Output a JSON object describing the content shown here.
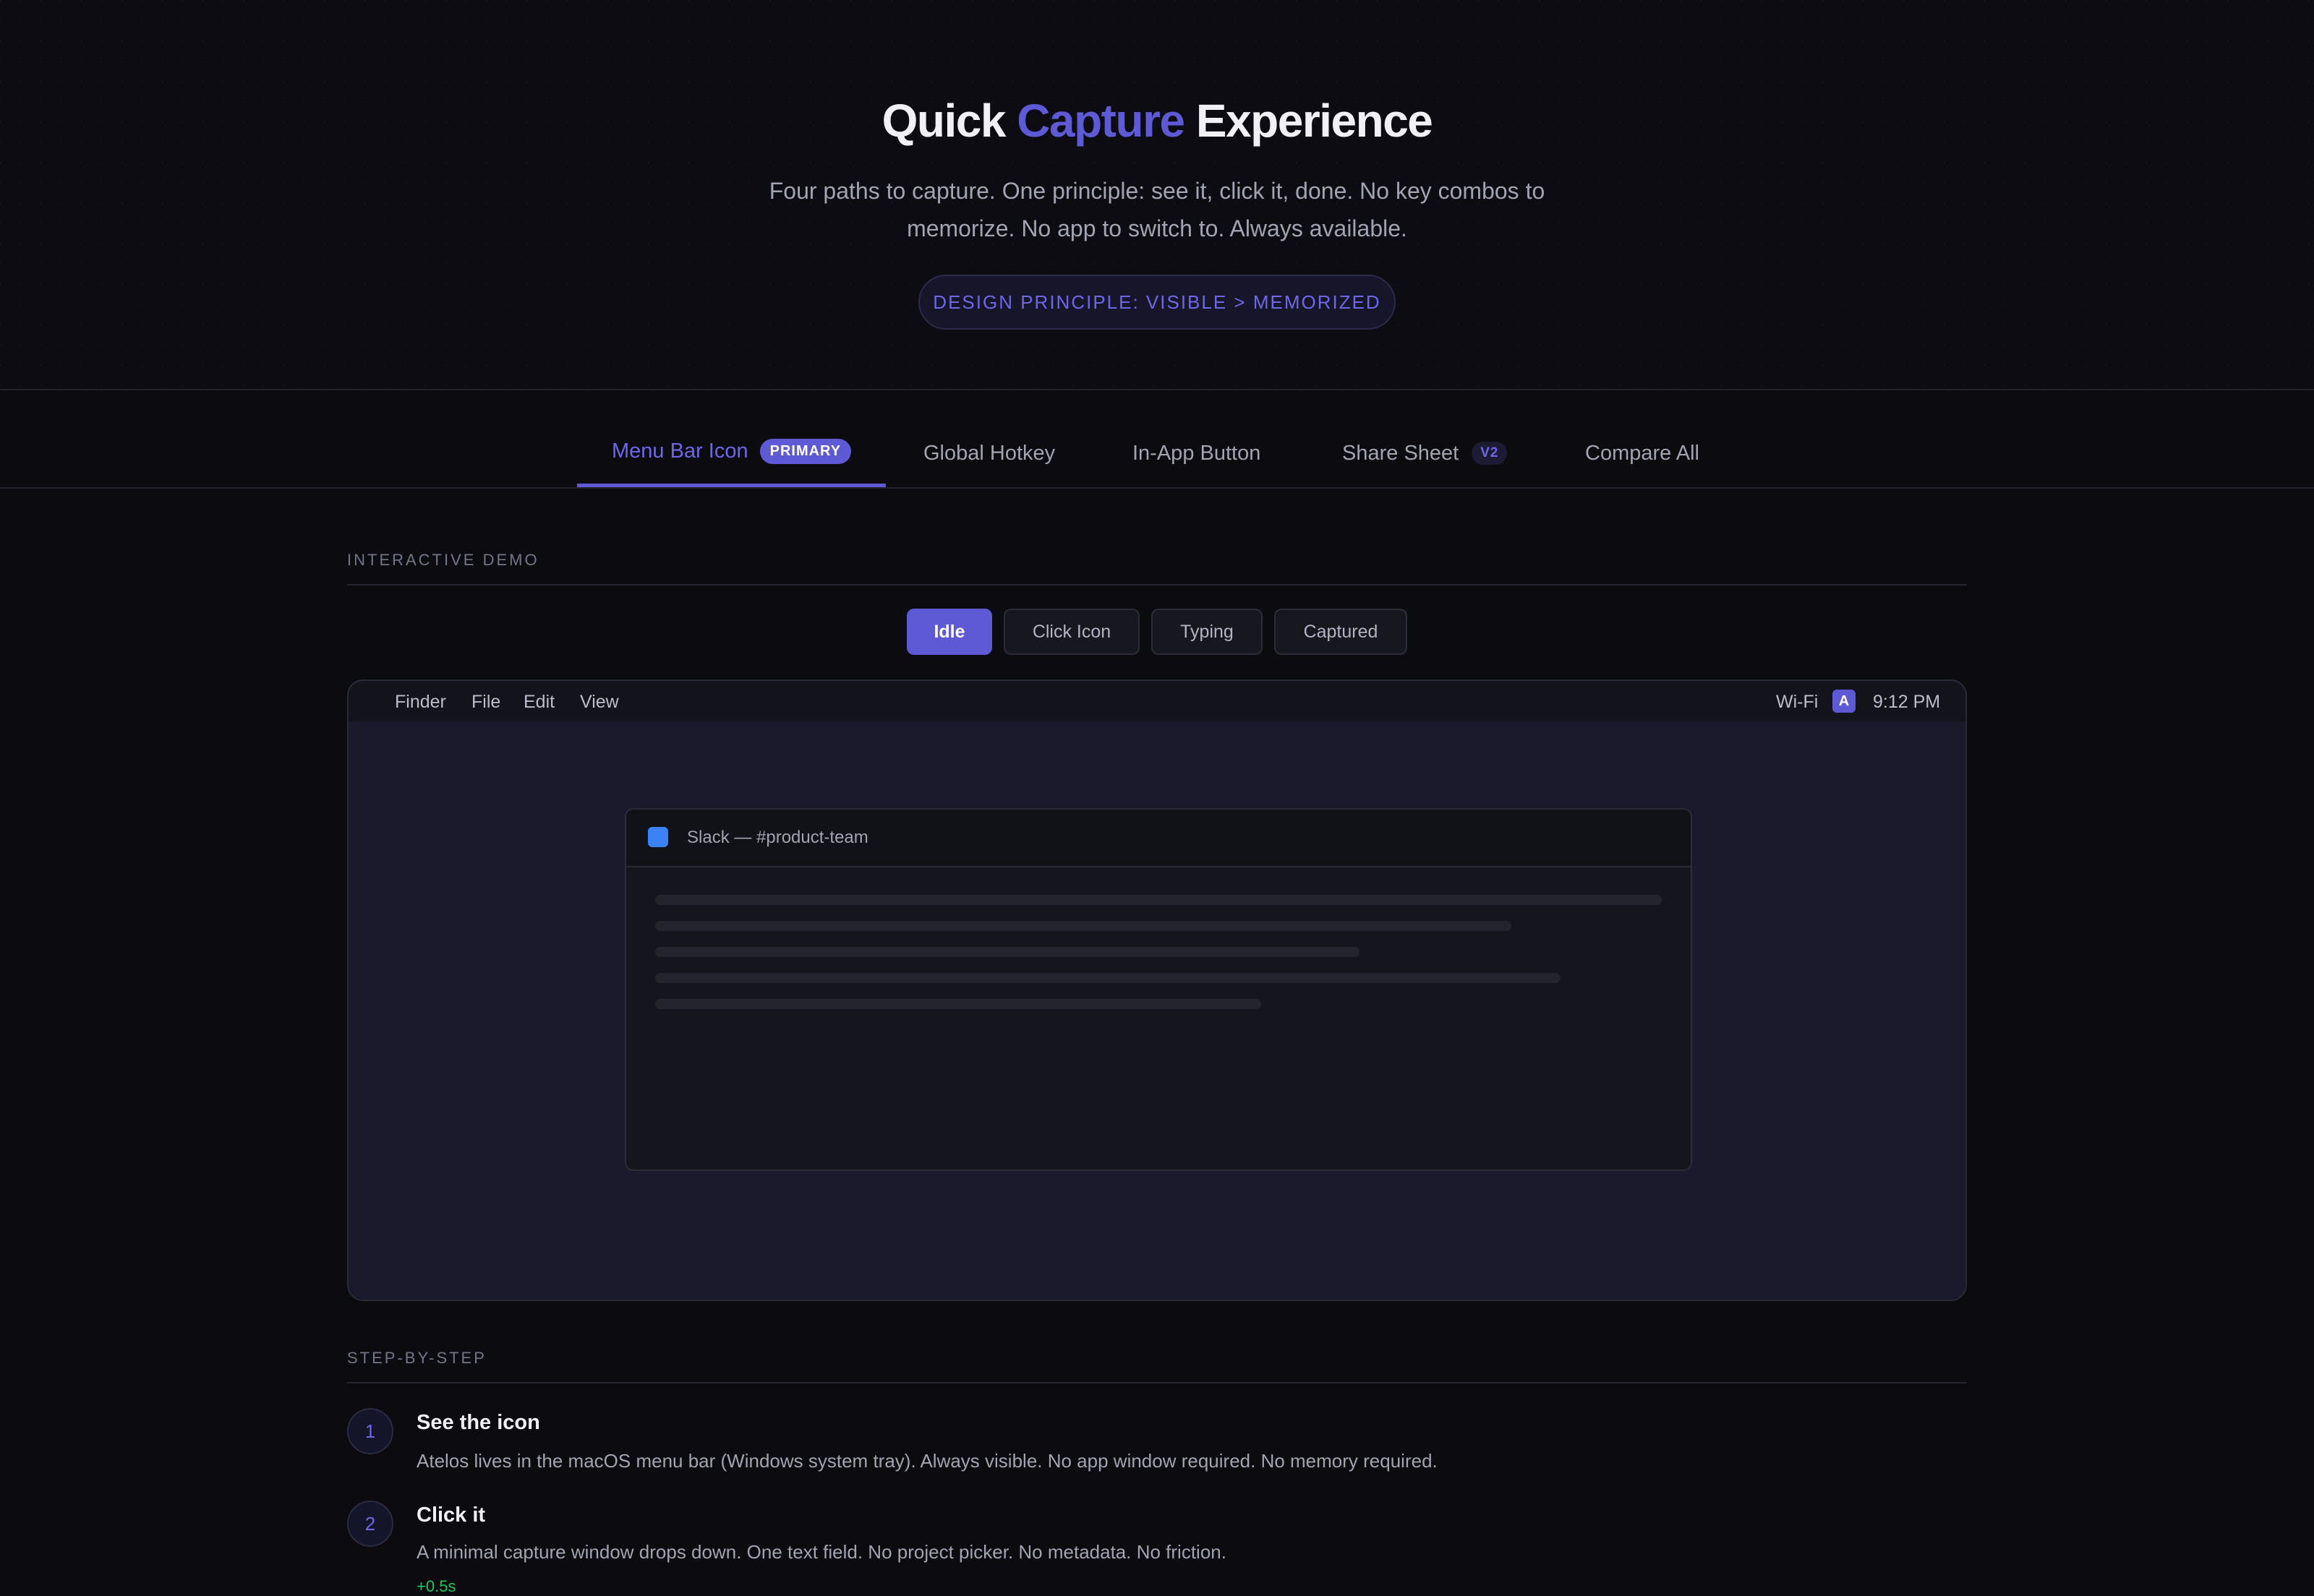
{
  "hero": {
    "title_prefix": "Quick",
    "title_accent": "Capture",
    "title_suffix": "Experience",
    "subtitle": "Four paths to capture. One principle: see it, click it, done. No key combos to memorize. No app to switch to. Always available.",
    "principle": "DESIGN PRINCIPLE: VISIBLE > MEMORIZED"
  },
  "tabs": [
    {
      "label": "Menu Bar Icon",
      "badge": "PRIMARY",
      "active": true
    },
    {
      "label": "Global Hotkey"
    },
    {
      "label": "In-App Button"
    },
    {
      "label": "Share Sheet",
      "badge": "V2"
    },
    {
      "label": "Compare All"
    }
  ],
  "demo": {
    "section_label": "INTERACTIVE DEMO",
    "states": [
      "Idle",
      "Click Icon",
      "Typing",
      "Captured"
    ],
    "active_state": "Idle",
    "menubar": {
      "left": [
        "Finder",
        "File",
        "Edit",
        "View"
      ],
      "wifi": "Wi-Fi",
      "app_icon": "A",
      "time": "9:12 PM"
    },
    "window_title": "Slack — #product-team"
  },
  "steps": {
    "section_label": "STEP-BY-STEP",
    "items": [
      {
        "num": "1",
        "title": "See the icon",
        "desc": "Atelos lives in the macOS menu bar (Windows system tray). Always visible. No app window required. No memory required."
      },
      {
        "num": "2",
        "title": "Click it",
        "desc": "A minimal capture window drops down. One text field. No project picker. No metadata. No friction.",
        "time": "+0.5s"
      }
    ]
  },
  "colors": {
    "accent": "#5e5ad6",
    "background": "#0b0b10",
    "success": "#22c55e",
    "window_dot": "#3b82f6"
  }
}
